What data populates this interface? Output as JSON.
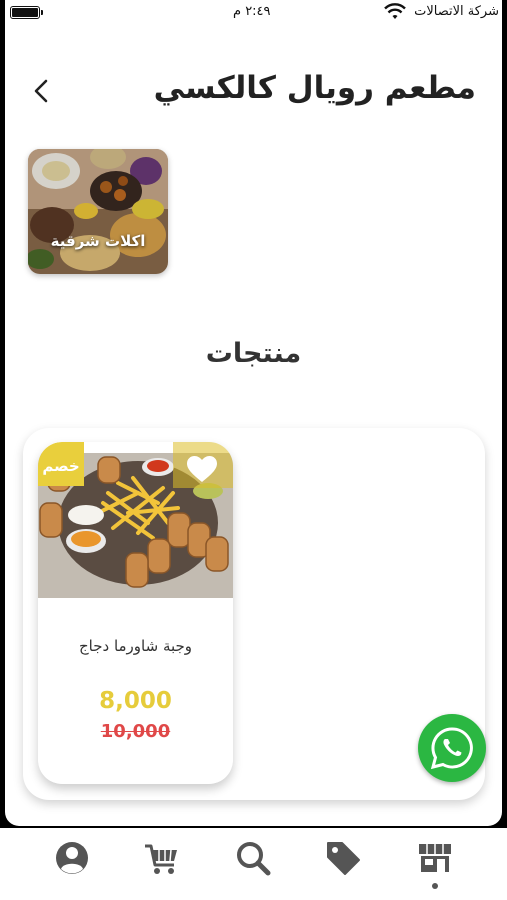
{
  "status_bar": {
    "carrier": "شركة الاتصالات",
    "time": "٢:٤٩ م"
  },
  "header": {
    "title": "مطعم رويال كالكسي",
    "back_icon": "chevron-left-icon"
  },
  "categories": [
    {
      "label": "اكلات شرقية"
    }
  ],
  "section_title": "منتجات",
  "products": [
    {
      "name": "وجبة شاورما دجاج",
      "price": "8,000",
      "old_price": "10,000",
      "badge": "خصم",
      "favorite_icon": "heart-icon"
    }
  ],
  "bottom_nav": {
    "items": [
      "profile-icon",
      "cart-icon",
      "search-icon",
      "tag-icon",
      "store-icon"
    ],
    "active": "store-icon"
  },
  "colors": {
    "accent": "#e6cc3b",
    "old_price": "#e04848",
    "whatsapp": "#2bb742",
    "nav_icon": "#555555"
  }
}
